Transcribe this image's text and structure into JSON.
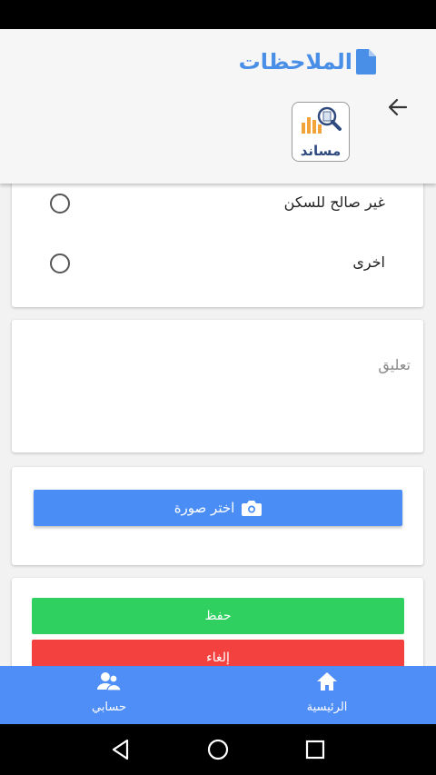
{
  "header": {
    "title": "الملاحظات",
    "logo_text": "مساند",
    "title_color": "#4a8fe7"
  },
  "options": [
    {
      "label": "غير صالح للسكن",
      "selected": false
    },
    {
      "label": "اخرى",
      "selected": false
    }
  ],
  "comment": {
    "placeholder": "تعليق",
    "value": ""
  },
  "image_picker": {
    "label": "اختر صورة",
    "color": "#4a8ef5"
  },
  "actions": {
    "save_label": "حفظ",
    "save_color": "#2fd060",
    "cancel_label": "إلغاء",
    "cancel_color": "#f3413f"
  },
  "bottom_nav": {
    "home_label": "الرئيسية",
    "account_label": "حسابي",
    "color": "#4f8ef7"
  },
  "icons": {
    "header": "document-icon",
    "back": "arrow-left-icon",
    "picker": "camera-icon",
    "home": "home-icon",
    "account": "users-icon"
  }
}
